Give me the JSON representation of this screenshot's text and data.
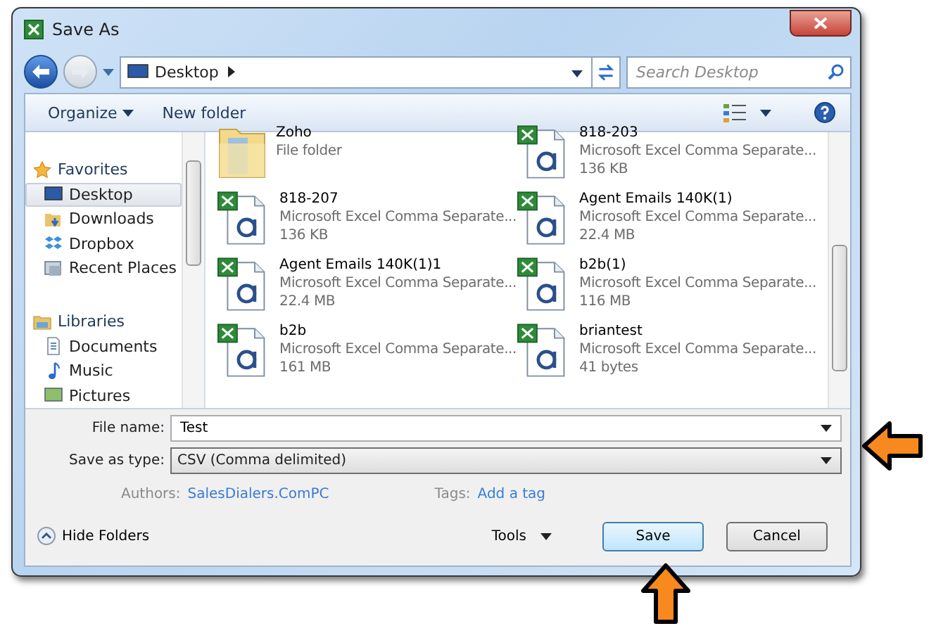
{
  "window": {
    "title": "Save As"
  },
  "address": {
    "location": "Desktop",
    "search_placeholder": "Search Desktop"
  },
  "toolbar": {
    "organize": "Organize",
    "new_folder": "New folder"
  },
  "sidebar": {
    "groups": [
      {
        "label": "Favorites",
        "kind": "star",
        "children": [
          {
            "label": "Desktop",
            "kind": "desktop",
            "selected": true
          },
          {
            "label": "Downloads",
            "kind": "downloads",
            "selected": false
          },
          {
            "label": "Dropbox",
            "kind": "dropbox",
            "selected": false
          },
          {
            "label": "Recent Places",
            "kind": "recent",
            "selected": false
          }
        ]
      },
      {
        "label": "Libraries",
        "kind": "libraries",
        "children": [
          {
            "label": "Documents",
            "kind": "documents",
            "selected": false
          },
          {
            "label": "Music",
            "kind": "music",
            "selected": false
          },
          {
            "label": "Pictures",
            "kind": "pictures",
            "selected": false
          }
        ]
      }
    ]
  },
  "files": [
    {
      "name": "Zoho",
      "kind": "folder",
      "type": "File folder"
    },
    {
      "name": "818-203",
      "kind": "excel",
      "type": "Microsoft Excel Comma Separate...",
      "size": "136 KB"
    },
    {
      "name": "818-207",
      "kind": "excel",
      "type": "Microsoft Excel Comma Separate...",
      "size": "136 KB"
    },
    {
      "name": "Agent Emails 140K(1)",
      "kind": "excel",
      "type": "Microsoft Excel Comma Separate...",
      "size": "22.4 MB"
    },
    {
      "name": "Agent Emails 140K(1)1",
      "kind": "excel",
      "type": "Microsoft Excel Comma Separate...",
      "size": "22.4 MB"
    },
    {
      "name": "b2b(1)",
      "kind": "excel",
      "type": "Microsoft Excel Comma Separate...",
      "size": "116 MB"
    },
    {
      "name": "b2b",
      "kind": "excel",
      "type": "Microsoft Excel Comma Separate...",
      "size": "161 MB"
    },
    {
      "name": "briantest",
      "kind": "excel",
      "type": "Microsoft Excel Comma Separate...",
      "size": "41 bytes"
    }
  ],
  "form": {
    "file_name_label": "File name:",
    "file_name": "Test",
    "type_label": "Save as type:",
    "type": "CSV (Comma delimited)",
    "authors_label": "Authors:",
    "authors": "SalesDialers.ComPC",
    "tags_label": "Tags:",
    "tags": "Add a tag"
  },
  "footer": {
    "hide_folders": "Hide Folders",
    "tools": "Tools",
    "save": "Save",
    "cancel": "Cancel"
  }
}
